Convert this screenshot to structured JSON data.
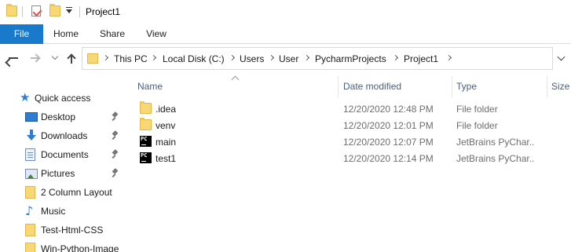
{
  "window": {
    "title": "Project1"
  },
  "quick_access_icons": [
    "folder-icon",
    "properties-check-icon",
    "new-folder-icon",
    "customize-dropdown-icon"
  ],
  "ribbon": {
    "tabs": [
      {
        "label": "File",
        "active": true,
        "color": "#1979ca"
      },
      {
        "label": "Home"
      },
      {
        "label": "Share"
      },
      {
        "label": "View"
      }
    ]
  },
  "address_bar": {
    "breadcrumbs": [
      "This PC",
      "Local Disk (C:)",
      "Users",
      "User",
      "PycharmProjects",
      "Project1"
    ]
  },
  "sidebar": {
    "items": [
      {
        "label": "Quick access",
        "icon": "star-icon"
      },
      {
        "label": "Desktop",
        "icon": "desktop-icon",
        "pinned": true
      },
      {
        "label": "Downloads",
        "icon": "download-icon",
        "pinned": true
      },
      {
        "label": "Documents",
        "icon": "documents-icon",
        "pinned": true
      },
      {
        "label": "Pictures",
        "icon": "pictures-icon",
        "pinned": true
      },
      {
        "label": "2 Column Layout",
        "icon": "folder-icon"
      },
      {
        "label": "Music",
        "icon": "music-icon"
      },
      {
        "label": "Test-Html-CSS",
        "icon": "folder-icon"
      },
      {
        "label": "Win-Python-Image",
        "icon": "folder-icon"
      }
    ]
  },
  "file_list": {
    "columns": [
      "Name",
      "Date modified",
      "Type",
      "Size"
    ],
    "rows": [
      {
        "name": ".idea",
        "date": "12/20/2020 12:48 PM",
        "type": "File folder",
        "icon": "folder-icon"
      },
      {
        "name": "venv",
        "date": "12/20/2020 12:01 PM",
        "type": "File folder",
        "icon": "folder-icon"
      },
      {
        "name": "main",
        "date": "12/20/2020 12:07 PM",
        "type": "JetBrains PyChar...",
        "icon": "pycharm-file-icon"
      },
      {
        "name": "test1",
        "date": "12/20/2020 12:14 PM",
        "type": "JetBrains PyChar...",
        "icon": "pycharm-file-icon"
      }
    ]
  }
}
